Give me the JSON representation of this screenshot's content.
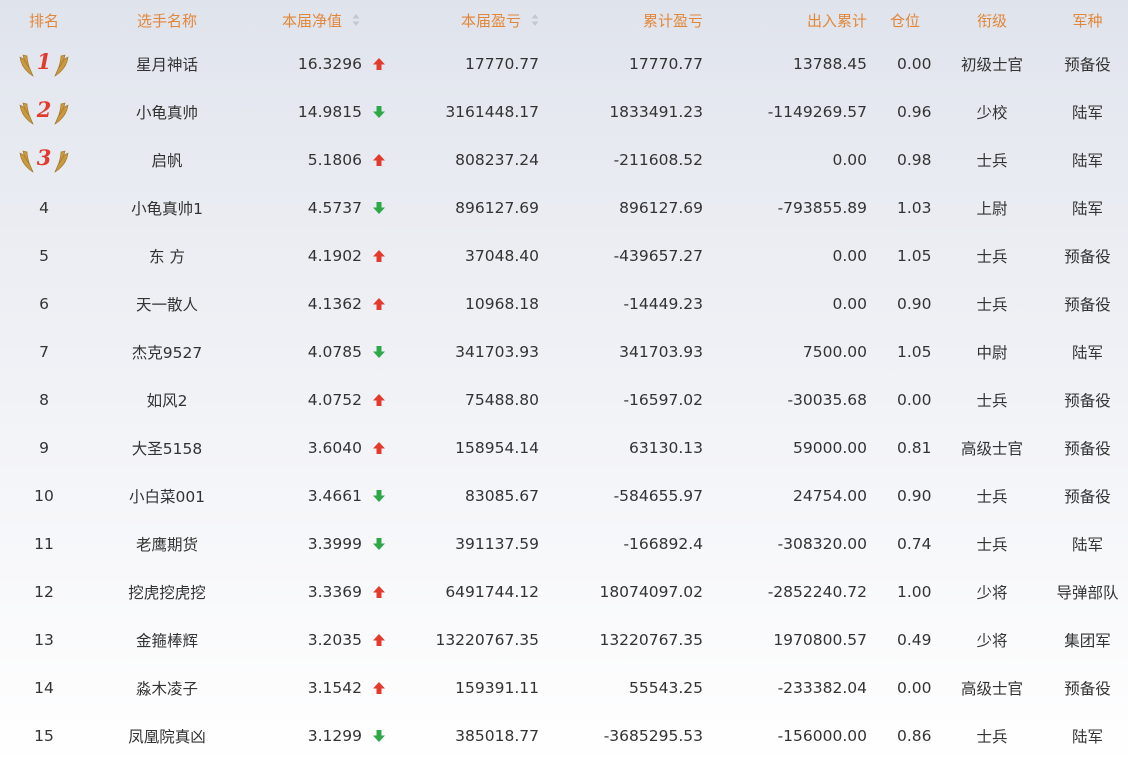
{
  "header": {
    "rank": "排名",
    "name": "选手名称",
    "nav": "本届净值",
    "pl": "本届盈亏",
    "cum_pl": "累计盈亏",
    "io": "出入累计",
    "position": "仓位",
    "title": "衔级",
    "arm": "军种"
  },
  "colors": {
    "header_text": "#e2873a",
    "up_arrow": "#e23b2e",
    "down_arrow": "#2fa84a",
    "medal_number": "#e23b2e",
    "wing_gold": "#c9983f"
  },
  "rows": [
    {
      "rank": "1",
      "medal": true,
      "name": "星月神话",
      "nav": "16.3296",
      "trend": "up",
      "pl": "17770.77",
      "cum_pl": "17770.77",
      "io": "13788.45",
      "position": "0.00",
      "title": "初级士官",
      "arm": "预备役"
    },
    {
      "rank": "2",
      "medal": true,
      "name": "小龟真帅",
      "nav": "14.9815",
      "trend": "down",
      "pl": "3161448.17",
      "cum_pl": "1833491.23",
      "io": "-1149269.57",
      "position": "0.96",
      "title": "少校",
      "arm": "陆军"
    },
    {
      "rank": "3",
      "medal": true,
      "name": "启帆",
      "nav": "5.1806",
      "trend": "up",
      "pl": "808237.24",
      "cum_pl": "-211608.52",
      "io": "0.00",
      "position": "0.98",
      "title": "士兵",
      "arm": "陆军"
    },
    {
      "rank": "4",
      "medal": false,
      "name": "小龟真帅1",
      "nav": "4.5737",
      "trend": "down",
      "pl": "896127.69",
      "cum_pl": "896127.69",
      "io": "-793855.89",
      "position": "1.03",
      "title": "上尉",
      "arm": "陆军"
    },
    {
      "rank": "5",
      "medal": false,
      "name": "东 方",
      "nav": "4.1902",
      "trend": "up",
      "pl": "37048.40",
      "cum_pl": "-439657.27",
      "io": "0.00",
      "position": "1.05",
      "title": "士兵",
      "arm": "预备役"
    },
    {
      "rank": "6",
      "medal": false,
      "name": "天一散人",
      "nav": "4.1362",
      "trend": "up",
      "pl": "10968.18",
      "cum_pl": "-14449.23",
      "io": "0.00",
      "position": "0.90",
      "title": "士兵",
      "arm": "预备役"
    },
    {
      "rank": "7",
      "medal": false,
      "name": "杰克9527",
      "nav": "4.0785",
      "trend": "down",
      "pl": "341703.93",
      "cum_pl": "341703.93",
      "io": "7500.00",
      "position": "1.05",
      "title": "中尉",
      "arm": "陆军"
    },
    {
      "rank": "8",
      "medal": false,
      "name": "如风2",
      "nav": "4.0752",
      "trend": "up",
      "pl": "75488.80",
      "cum_pl": "-16597.02",
      "io": "-30035.68",
      "position": "0.00",
      "title": "士兵",
      "arm": "预备役"
    },
    {
      "rank": "9",
      "medal": false,
      "name": "大圣5158",
      "nav": "3.6040",
      "trend": "up",
      "pl": "158954.14",
      "cum_pl": "63130.13",
      "io": "59000.00",
      "position": "0.81",
      "title": "高级士官",
      "arm": "预备役"
    },
    {
      "rank": "10",
      "medal": false,
      "name": "小白菜001",
      "nav": "3.4661",
      "trend": "down",
      "pl": "83085.67",
      "cum_pl": "-584655.97",
      "io": "24754.00",
      "position": "0.90",
      "title": "士兵",
      "arm": "预备役"
    },
    {
      "rank": "11",
      "medal": false,
      "name": "老鹰期货",
      "nav": "3.3999",
      "trend": "down",
      "pl": "391137.59",
      "cum_pl": "-166892.4",
      "io": "-308320.00",
      "position": "0.74",
      "title": "士兵",
      "arm": "陆军"
    },
    {
      "rank": "12",
      "medal": false,
      "name": "挖虎挖虎挖",
      "nav": "3.3369",
      "trend": "up",
      "pl": "6491744.12",
      "cum_pl": "18074097.02",
      "io": "-2852240.72",
      "position": "1.00",
      "title": "少将",
      "arm": "导弹部队"
    },
    {
      "rank": "13",
      "medal": false,
      "name": "金箍棒辉",
      "nav": "3.2035",
      "trend": "up",
      "pl": "13220767.35",
      "cum_pl": "13220767.35",
      "io": "1970800.57",
      "position": "0.49",
      "title": "少将",
      "arm": "集团军"
    },
    {
      "rank": "14",
      "medal": false,
      "name": "淼木凌子",
      "nav": "3.1542",
      "trend": "up",
      "pl": "159391.11",
      "cum_pl": "55543.25",
      "io": "-233382.04",
      "position": "0.00",
      "title": "高级士官",
      "arm": "预备役"
    },
    {
      "rank": "15",
      "medal": false,
      "name": "凤凰院真凶",
      "nav": "3.1299",
      "trend": "down",
      "pl": "385018.77",
      "cum_pl": "-3685295.53",
      "io": "-156000.00",
      "position": "0.86",
      "title": "士兵",
      "arm": "陆军"
    }
  ]
}
